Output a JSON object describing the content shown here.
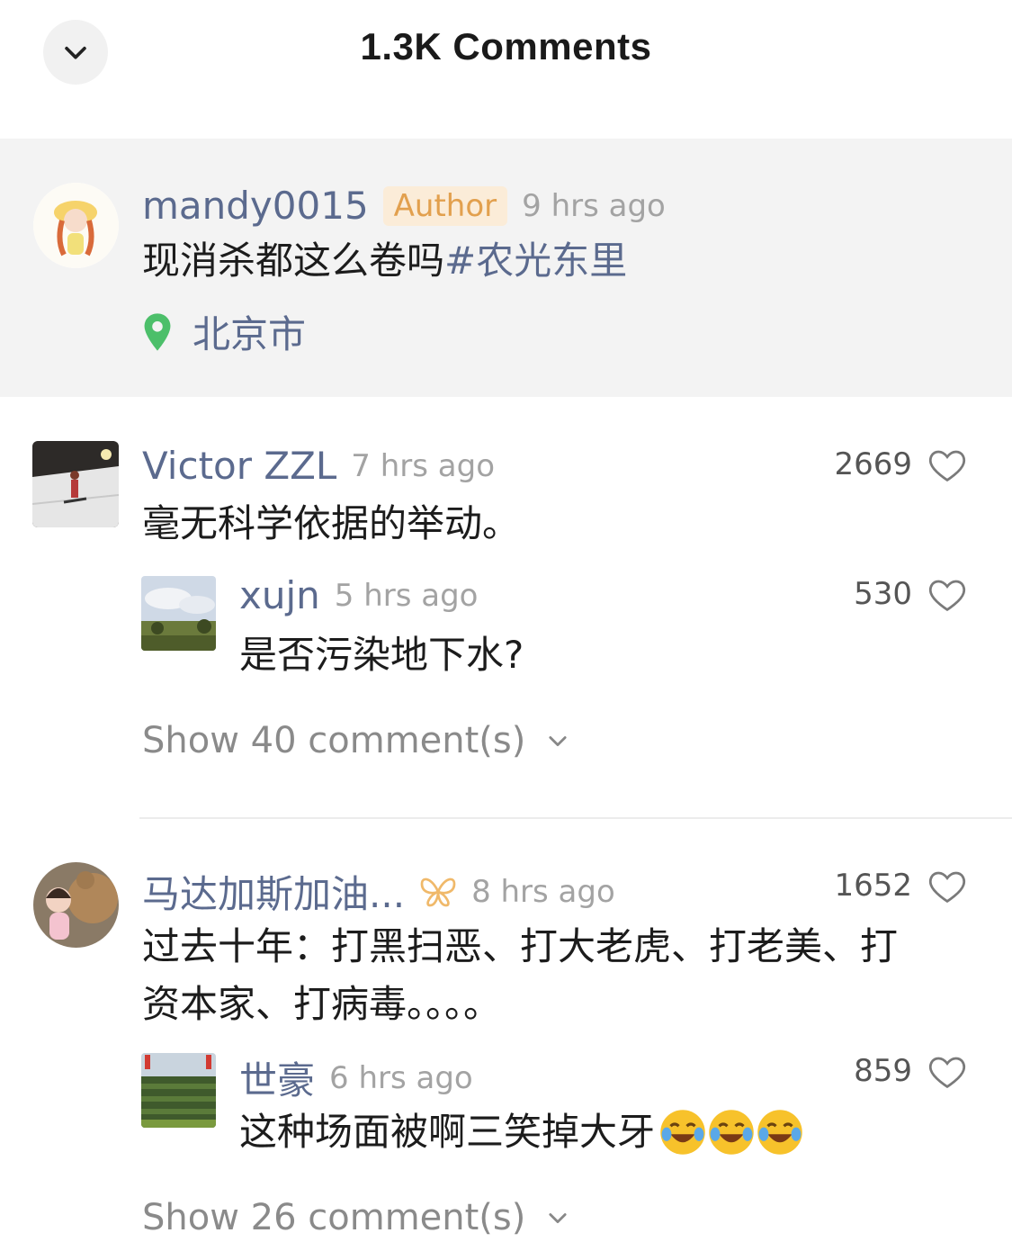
{
  "header": {
    "title": "1.3K Comments"
  },
  "post": {
    "username": "mandy0015",
    "badge": "Author",
    "time": "9 hrs ago",
    "text": "现消杀都这么卷吗",
    "hashtag": "#农光东里",
    "location": "北京市"
  },
  "comments": [
    {
      "username": "Victor ZZL",
      "time": "7 hrs ago",
      "likes": "2669",
      "text": "毫无科学依据的举动。",
      "reply": {
        "username": "xujn",
        "time": "5 hrs ago",
        "likes": "530",
        "text": "是否污染地下水?"
      },
      "show_more": "Show 40 comment(s)"
    },
    {
      "username": "马达加斯加油...",
      "time": "8 hrs ago",
      "likes": "1652",
      "text_line1": "过去十年：打黑扫恶、打大老虎、打老美、打",
      "text_line2": "资本家、打病毒。。。。",
      "reply": {
        "username": "世豪",
        "time": "6 hrs ago",
        "likes": "859",
        "text": "这种场面被啊三笑掉大牙"
      },
      "show_more": "Show 26 comment(s)"
    }
  ],
  "colors": {
    "username": "#5b6a8e",
    "badge_bg": "#fbecd8",
    "badge_text": "#e2a04e",
    "location_pin": "#4cbf6a",
    "vip_icon": "#f0b96a"
  }
}
